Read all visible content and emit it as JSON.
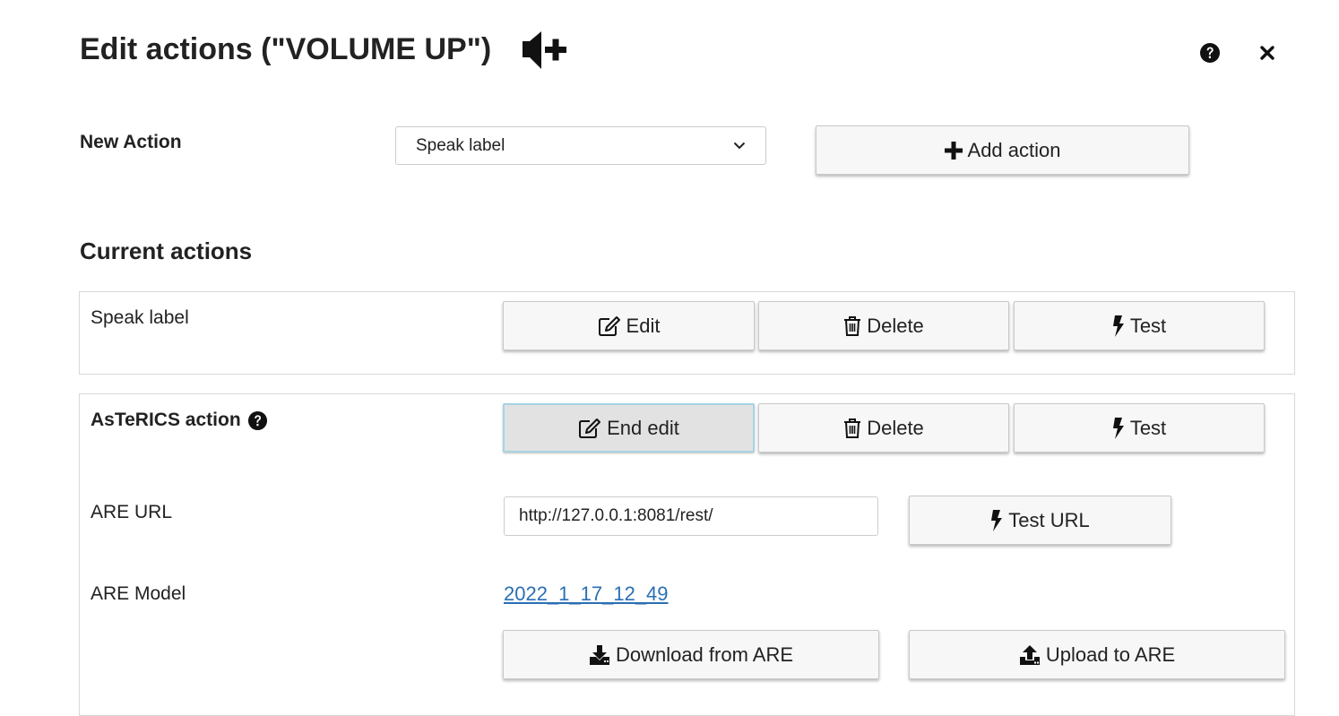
{
  "dialog": {
    "title": "Edit actions (\"VOLUME UP\")",
    "header_icon": "volume-up-icon",
    "help_icon": "question-circle-icon",
    "close_icon": "close-icon"
  },
  "new_action": {
    "label": "New Action",
    "select_value": "Speak label",
    "add_button_label": "Add action"
  },
  "current_actions": {
    "heading": "Current actions",
    "items": [
      {
        "label": "Speak label",
        "edit_label": "Edit",
        "delete_label": "Delete",
        "test_label": "Test"
      },
      {
        "label": "AsTeRICS action",
        "edit_label": "End edit",
        "delete_label": "Delete",
        "test_label": "Test",
        "are_url_label": "ARE URL",
        "are_url_value": "http://127.0.0.1:8081/rest/",
        "test_url_label": "Test URL",
        "are_model_label": "ARE Model",
        "are_model_link": "2022_1_17_12_49",
        "download_label": "Download from ARE",
        "upload_label": "Upload to ARE"
      }
    ]
  },
  "colors": {
    "link": "#2a6fb5",
    "active_border": "#a6d4e3",
    "button_bg": "#f7f7f7"
  }
}
